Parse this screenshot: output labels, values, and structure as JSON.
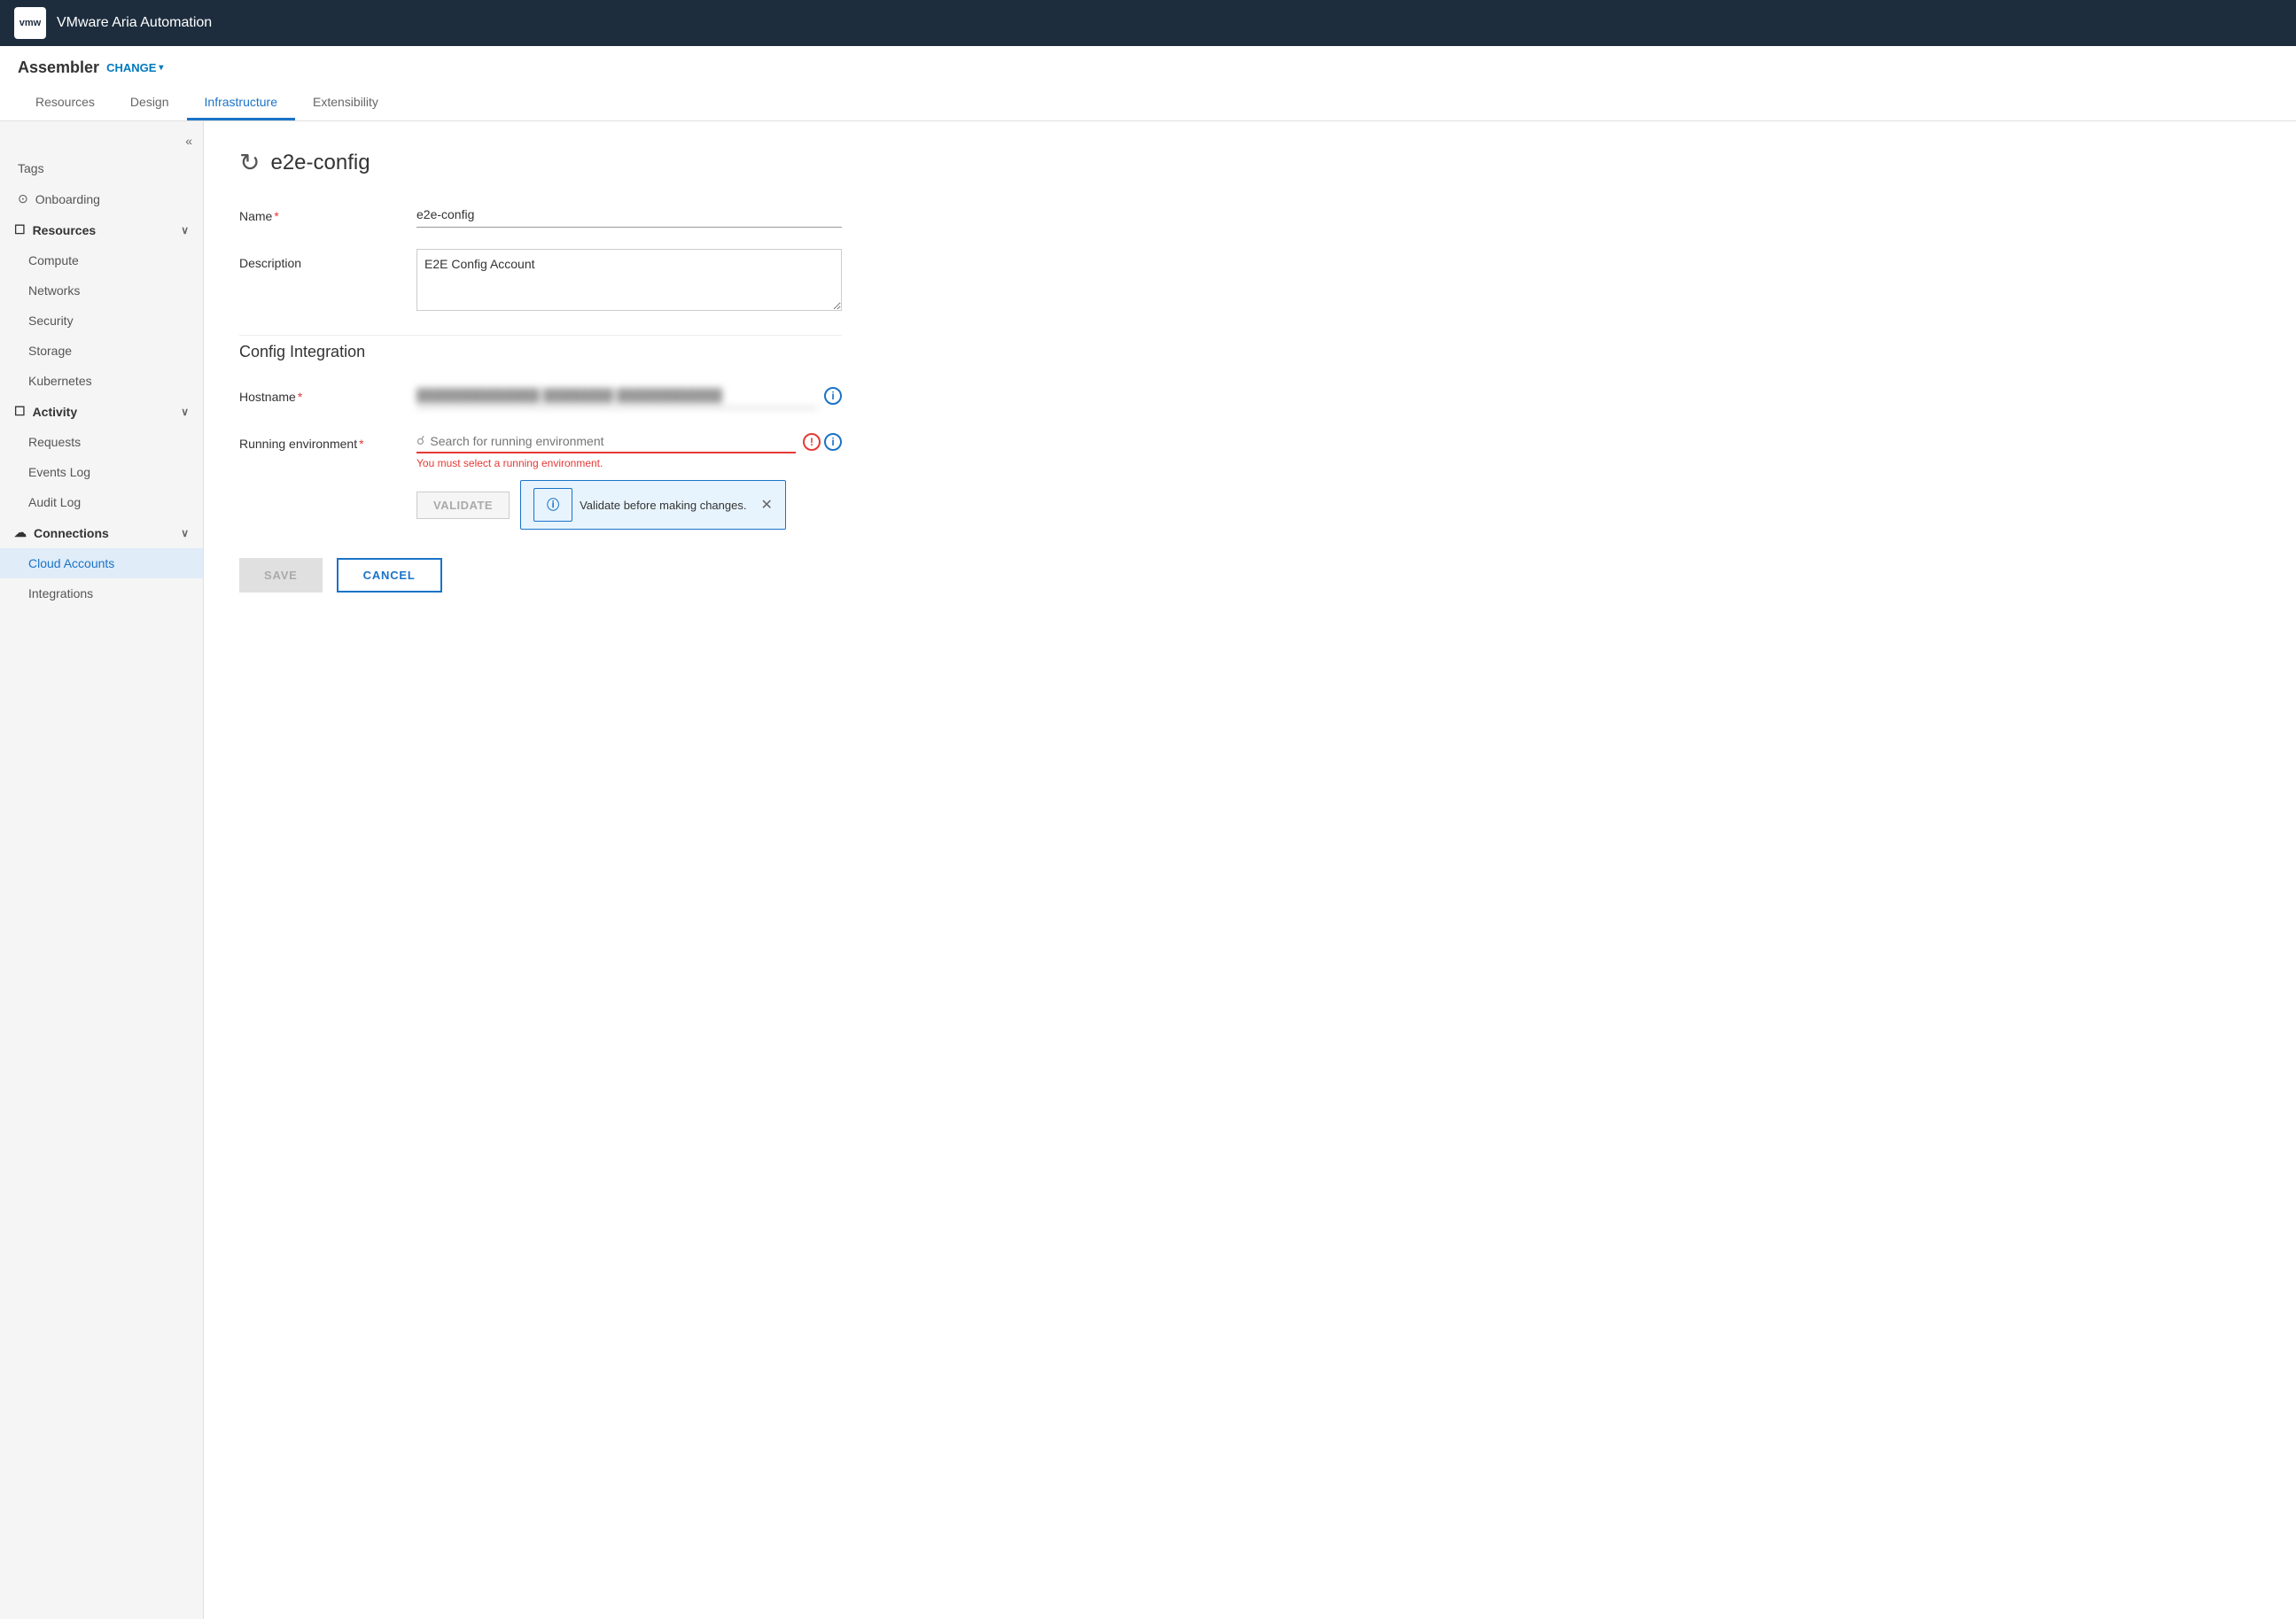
{
  "app": {
    "name": "VMware Aria Automation",
    "logo": "vmw"
  },
  "header": {
    "project": "Assembler",
    "change_label": "CHANGE",
    "chevron": "▾"
  },
  "tabs": [
    {
      "id": "resources",
      "label": "Resources",
      "active": false
    },
    {
      "id": "design",
      "label": "Design",
      "active": false
    },
    {
      "id": "infrastructure",
      "label": "Infrastructure",
      "active": true
    },
    {
      "id": "extensibility",
      "label": "Extensibility",
      "active": false
    }
  ],
  "sidebar": {
    "collapse_icon": "«",
    "items": [
      {
        "id": "tags",
        "label": "Tags",
        "type": "item",
        "indent": false
      },
      {
        "id": "onboarding",
        "label": "Onboarding",
        "type": "section-item",
        "icon": "⊙",
        "indent": false
      },
      {
        "id": "resources",
        "label": "Resources",
        "type": "section",
        "icon": "☐",
        "expanded": true
      },
      {
        "id": "compute",
        "label": "Compute",
        "type": "item",
        "indent": true
      },
      {
        "id": "networks",
        "label": "Networks",
        "type": "item",
        "indent": true
      },
      {
        "id": "security",
        "label": "Security",
        "type": "item",
        "indent": true
      },
      {
        "id": "storage",
        "label": "Storage",
        "type": "item",
        "indent": true
      },
      {
        "id": "kubernetes",
        "label": "Kubernetes",
        "type": "item",
        "indent": true
      },
      {
        "id": "activity",
        "label": "Activity",
        "type": "section",
        "icon": "☐",
        "expanded": true
      },
      {
        "id": "requests",
        "label": "Requests",
        "type": "item",
        "indent": true
      },
      {
        "id": "events-log",
        "label": "Events Log",
        "type": "item",
        "indent": true
      },
      {
        "id": "audit-log",
        "label": "Audit Log",
        "type": "item",
        "indent": true
      },
      {
        "id": "connections",
        "label": "Connections",
        "type": "section",
        "icon": "☁",
        "expanded": true
      },
      {
        "id": "cloud-accounts",
        "label": "Cloud Accounts",
        "type": "item",
        "indent": true,
        "active": true
      },
      {
        "id": "integrations",
        "label": "Integrations",
        "type": "item",
        "indent": true
      }
    ]
  },
  "page": {
    "icon": "↻",
    "title": "e2e-config",
    "form": {
      "name_label": "Name",
      "name_required": "*",
      "name_value": "e2e-config",
      "description_label": "Description",
      "description_value": "E2E Config Account",
      "config_integration_title": "Config Integration",
      "hostname_label": "Hostname",
      "hostname_required": "*",
      "hostname_value": "██████████ ██████ ████████",
      "running_env_label": "Running environment",
      "running_env_required": "*",
      "running_env_placeholder": "Search for running environment",
      "running_env_error": "You must select a running environment.",
      "validate_btn_label": "VALIDATE",
      "validate_message": "Validate before making changes.",
      "save_label": "SAVE",
      "cancel_label": "CANCEL"
    }
  }
}
